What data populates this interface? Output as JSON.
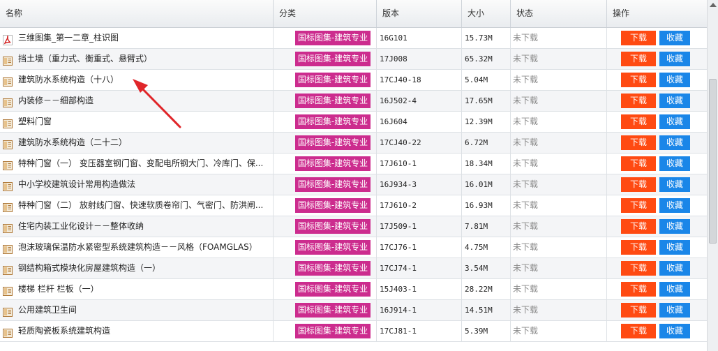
{
  "columns": {
    "name": "名称",
    "category": "分类",
    "version": "版本",
    "size": "大小",
    "status": "状态",
    "actions": "操作"
  },
  "buttons": {
    "download": "下载",
    "favorite": "收藏"
  },
  "colors": {
    "category_badge": "#cc2c8e",
    "download": "#ff4a12",
    "favorite": "#1a86e8",
    "annotation_arrow": "#e0262a"
  },
  "rows": [
    {
      "icon": "pdf-icon",
      "name": "三维图集_第一二章_柱识图",
      "category": "国标图集-建筑专业",
      "version": "16G101",
      "size": "15.73M",
      "status": "未下载"
    },
    {
      "icon": "book-icon",
      "name": "挡土墙（重力式、衡重式、悬臂式）",
      "category": "国标图集-建筑专业",
      "version": "17J008",
      "size": "65.32M",
      "status": "未下载"
    },
    {
      "icon": "book-icon",
      "name": "建筑防水系统构造（十八）",
      "category": "国标图集-建筑专业",
      "version": "17CJ40-18",
      "size": "5.04M",
      "status": "未下载"
    },
    {
      "icon": "book-icon",
      "name": "内装修－－细部构造",
      "category": "国标图集-建筑专业",
      "version": "16J502-4",
      "size": "17.65M",
      "status": "未下载"
    },
    {
      "icon": "book-icon",
      "name": "塑料门窗",
      "category": "国标图集-建筑专业",
      "version": "16J604",
      "size": "12.39M",
      "status": "未下载"
    },
    {
      "icon": "book-icon",
      "name": "建筑防水系统构造（二十二）",
      "category": "国标图集-建筑专业",
      "version": "17CJ40-22",
      "size": "6.72M",
      "status": "未下载"
    },
    {
      "icon": "book-icon",
      "name": "特种门窗（一） 变压器室钢门窗、变配电所钢大门、冷库门、保...",
      "category": "国标图集-建筑专业",
      "version": "17J610-1",
      "size": "18.34M",
      "status": "未下载"
    },
    {
      "icon": "book-icon",
      "name": "中小学校建筑设计常用构造做法",
      "category": "国标图集-建筑专业",
      "version": "16J934-3",
      "size": "16.01M",
      "status": "未下载"
    },
    {
      "icon": "book-icon",
      "name": "特种门窗（二） 放射线门窗、快速软质卷帘门、气密门、防洪闸...",
      "category": "国标图集-建筑专业",
      "version": "17J610-2",
      "size": "16.93M",
      "status": "未下载"
    },
    {
      "icon": "book-icon",
      "name": "住宅内装工业化设计－－整体收纳",
      "category": "国标图集-建筑专业",
      "version": "17J509-1",
      "size": "7.81M",
      "status": "未下载"
    },
    {
      "icon": "book-icon",
      "name": "泡沫玻璃保温防水紧密型系统建筑构造－－风格（FOAMGLAS）",
      "category": "国标图集-建筑专业",
      "version": "17CJ76-1",
      "size": "4.75M",
      "status": "未下载"
    },
    {
      "icon": "book-icon",
      "name": "钢结构箱式模块化房屋建筑构造（一）",
      "category": "国标图集-建筑专业",
      "version": "17CJ74-1",
      "size": "3.54M",
      "status": "未下载"
    },
    {
      "icon": "book-icon",
      "name": "楼梯 栏杆 栏板（一）",
      "category": "国标图集-建筑专业",
      "version": "15J403-1",
      "size": "28.22M",
      "status": "未下载"
    },
    {
      "icon": "book-icon",
      "name": "公用建筑卫生间",
      "category": "国标图集-建筑专业",
      "version": "16J914-1",
      "size": "14.51M",
      "status": "未下载"
    },
    {
      "icon": "book-icon",
      "name": "轻质陶瓷板系统建筑构造",
      "category": "国标图集-建筑专业",
      "version": "17CJ81-1",
      "size": "5.39M",
      "status": "未下载"
    }
  ]
}
